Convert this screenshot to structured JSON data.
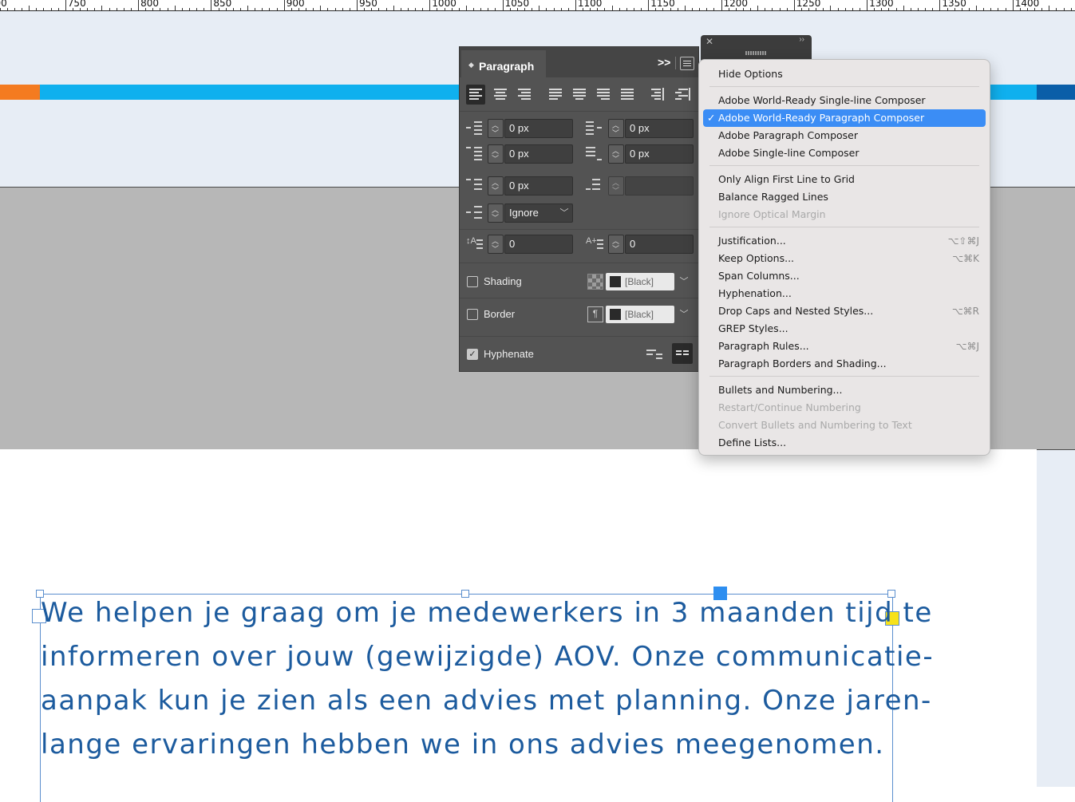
{
  "ruler": {
    "labels": [
      "00",
      "750",
      "800",
      "850",
      "900",
      "950",
      "1000",
      "1050",
      "1100",
      "1150",
      "1200",
      "1250",
      "1300",
      "1350",
      "1400"
    ]
  },
  "colors": {
    "orange": "#f47b20",
    "cyan": "#0fb0ee",
    "navy": "#0a5ea8",
    "body_text": "#1c5b9e",
    "menu_highlight": "#3b8df5"
  },
  "panel": {
    "title": "Paragraph",
    "left_indent": "0 px",
    "right_indent": "0 px",
    "first_line_indent": "0 px",
    "last_line_indent": "0 px",
    "space_before": "0 px",
    "space_after": "",
    "align_to_grid": "Ignore",
    "drop_cap_lines": "0",
    "drop_cap_chars": "0",
    "shading_label": "Shading",
    "shading_swatch": "[Black]",
    "border_label": "Border",
    "border_swatch": "[Black]",
    "hyphenate_label": "Hyphenate",
    "hyphenate_checked": true,
    "shading_checked": false,
    "border_checked": false,
    "icons": {
      "collapse": "double-chevron-right-icon",
      "menu": "panel-menu-icon"
    }
  },
  "menu": {
    "hide_options": "Hide Options",
    "composers": [
      {
        "label": "Adobe World-Ready Single-line Composer",
        "checked": false
      },
      {
        "label": "Adobe World-Ready Paragraph Composer",
        "checked": true
      },
      {
        "label": "Adobe Paragraph Composer",
        "checked": false
      },
      {
        "label": "Adobe Single-line Composer",
        "checked": false
      }
    ],
    "alignment_opts": [
      {
        "label": "Only Align First Line to Grid",
        "disabled": false
      },
      {
        "label": "Balance Ragged Lines",
        "disabled": false
      },
      {
        "label": "Ignore Optical Margin",
        "disabled": true
      }
    ],
    "dialogs": [
      {
        "label": "Justification...",
        "shortcut": "⌥⇧⌘J"
      },
      {
        "label": "Keep Options...",
        "shortcut": "⌥⌘K"
      },
      {
        "label": "Span Columns...",
        "shortcut": ""
      },
      {
        "label": "Hyphenation...",
        "shortcut": ""
      },
      {
        "label": "Drop Caps and Nested Styles...",
        "shortcut": "⌥⌘R"
      },
      {
        "label": "GREP Styles...",
        "shortcut": ""
      },
      {
        "label": "Paragraph Rules...",
        "shortcut": "⌥⌘J"
      },
      {
        "label": "Paragraph Borders and Shading...",
        "shortcut": ""
      }
    ],
    "lists": [
      {
        "label": "Bullets and Numbering...",
        "disabled": false
      },
      {
        "label": "Restart/Continue Numbering",
        "disabled": true
      },
      {
        "label": "Convert Bullets and Numbering to Text",
        "disabled": true
      },
      {
        "label": "Define Lists...",
        "disabled": false
      }
    ]
  },
  "document": {
    "lines": [
      "We helpen je graag om je medewerkers in 3 maanden tijd te",
      "informeren over jouw (gewijzigde) AOV. Onze communicatie-",
      "aanpak kun je zien als een advies met planning. Onze jaren-",
      "lange ervaringen hebben we in ons advies meegenomen."
    ]
  }
}
